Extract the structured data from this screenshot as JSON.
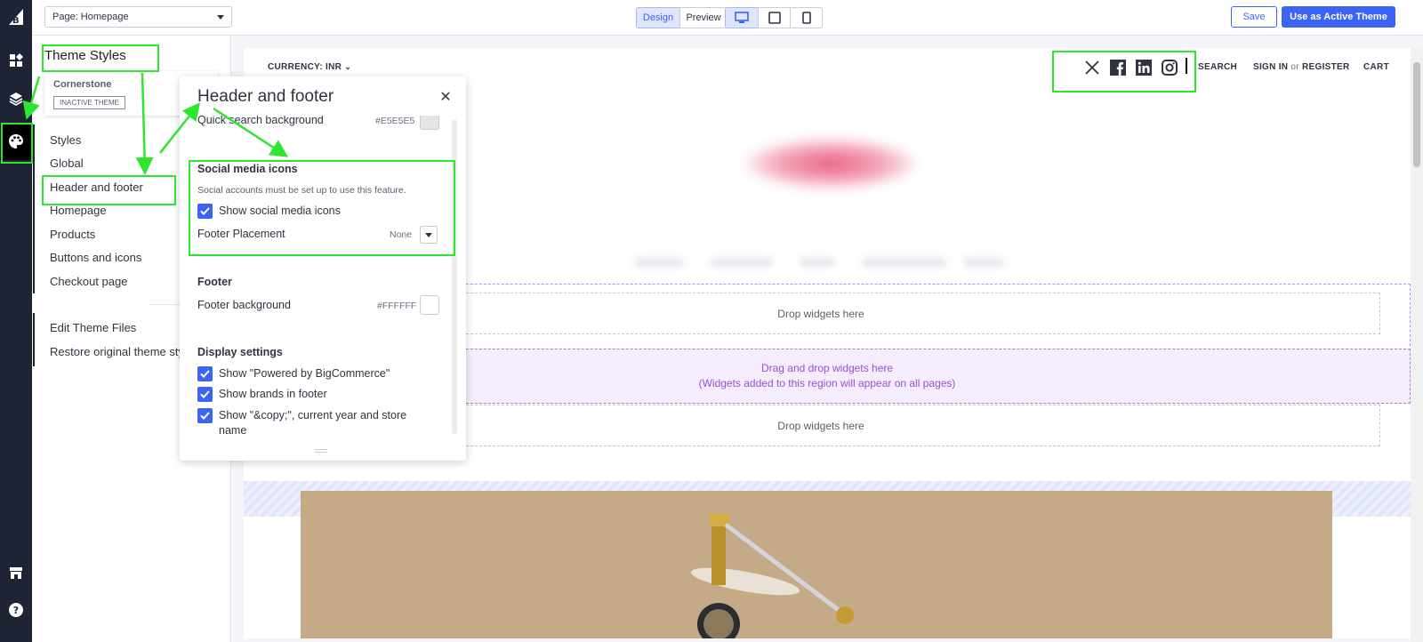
{
  "topbar": {
    "page_select": "Page: Homepage",
    "design_label": "Design",
    "preview_label": "Preview",
    "save_label": "Save",
    "active_theme_label": "Use as Active Theme"
  },
  "sidebar": {
    "annotation_title": "Theme Styles",
    "theme_name": "Cornerstone",
    "theme_badge": "INACTIVE THEME",
    "items": [
      "Styles",
      "Global",
      "Header and footer",
      "Homepage",
      "Products",
      "Buttons and icons",
      "Checkout page"
    ],
    "edit_files": "Edit Theme Files",
    "restore": "Restore original theme sty"
  },
  "panel": {
    "title": "Header and footer",
    "close_icon": "close-icon",
    "quick_search_label": "Quick search background",
    "quick_search_value": "#E5E5E5",
    "social_heading": "Social media icons",
    "social_note": "Social accounts must be set up to use this feature.",
    "show_social_label": "Show social media icons",
    "footer_placement_label": "Footer Placement",
    "footer_placement_value": "None",
    "footer_heading": "Footer",
    "footer_bg_label": "Footer background",
    "footer_bg_value": "#FFFFFF",
    "display_heading": "Display settings",
    "show_powered_label": "Show \"Powered by BigCommerce\"",
    "show_brands_label": "Show brands in footer",
    "show_copy_label": "Show \"&copy;\", current year and store name"
  },
  "canvas": {
    "currency": "CURRENCY: INR",
    "search": "SEARCH",
    "sign_in": "SIGN IN",
    "or": "or",
    "register": "REGISTER",
    "cart": "CART",
    "drop_widgets_1": "Drop widgets here",
    "global_line1": "Drag and drop widgets here",
    "global_line2": "(Widgets added to this region will appear on all pages)",
    "drop_widgets_2": "Drop widgets here",
    "social_icons": [
      "x-icon",
      "facebook-icon",
      "linkedin-icon",
      "instagram-icon"
    ]
  },
  "colors": {
    "accent": "#3C64F4",
    "annotation": "#2EE62E",
    "global_region": "#9A4FD0",
    "hero_bg": "#C4AA87"
  }
}
